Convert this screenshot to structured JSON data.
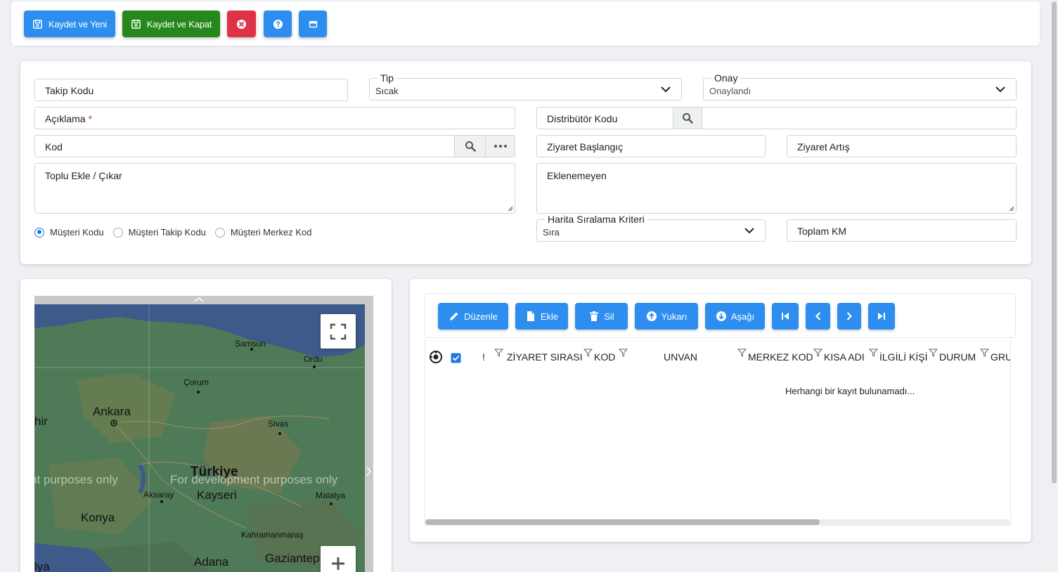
{
  "toolbar": {
    "save_new_label": "Kaydet ve Yeni",
    "save_close_label": "Kaydet ve Kapat"
  },
  "form": {
    "takip_kodu": "Takip Kodu",
    "tip": {
      "label": "Tip",
      "value": "Sıcak"
    },
    "onay": {
      "label": "Onay",
      "value": "Onaylandı"
    },
    "aciklama": "Açıklama",
    "aciklama_required": "*",
    "distributor_kodu": "Distribütör Kodu",
    "kod": "Kod",
    "ziyaret_baslangic": "Ziyaret Başlangıç",
    "ziyaret_artis": "Ziyaret Artış",
    "toplu_ekle": "Toplu Ekle / Çıkar",
    "eklenemeyen": "Eklenemeyen",
    "harita_siralama": {
      "label": "Harita Sıralama Kriteri",
      "value": "Sıra"
    },
    "toplam_km": "Toplam KM",
    "radios": [
      {
        "label": "Müşteri Kodu",
        "checked": true
      },
      {
        "label": "Müşteri Takip Kodu",
        "checked": false
      },
      {
        "label": "Müşteri Merkez Kod",
        "checked": false
      }
    ]
  },
  "map": {
    "cities": [
      "Samsun",
      "Ordu",
      "Çorum",
      "Ankara",
      "Sivas",
      "Türkiye",
      "Kayseri",
      "Aksaray",
      "Malatya",
      "Konya",
      "Kahramanmaraş",
      "Adana",
      "Gaziantep"
    ],
    "edge_labels": [
      "hir",
      "lya"
    ],
    "watermark": "For development purposes only",
    "watermark_partial": "nt purposes only"
  },
  "grid": {
    "buttons": {
      "edit": "Düzenle",
      "add": "Ekle",
      "delete": "Sil",
      "up": "Yukarı",
      "down": "Aşağı"
    },
    "columns": {
      "flag": "!",
      "ziyaret_sirasi": "ZİYARET SIRASI",
      "kod": "KOD",
      "unvan": "UNVAN",
      "merkez_kod": "MERKEZ KOD",
      "kisa_adi": "KISA ADI",
      "ilgili_kisi": "İLGİLİ KİŞİ",
      "durum": "DURUM",
      "gru": "GRU"
    },
    "empty_message": "Herhangi bir kayıt bulunamadı..."
  },
  "colors": {
    "primary": "#2d8ef0",
    "success": "#26881c",
    "danger": "#e03246"
  }
}
